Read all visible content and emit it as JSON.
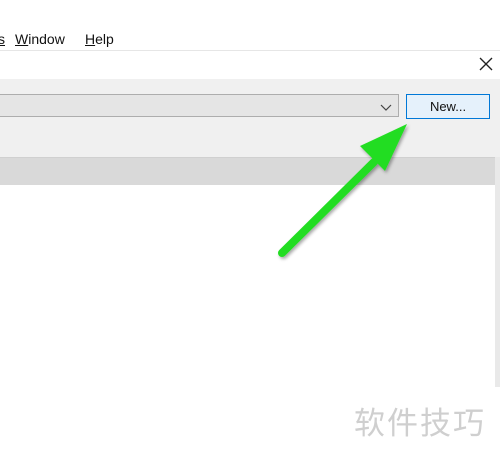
{
  "menubar": {
    "partial_item_tail": "s",
    "items": [
      {
        "accel": "W",
        "rest": "indow"
      },
      {
        "accel": "H",
        "rest": "elp"
      }
    ]
  },
  "dialog": {
    "selector": {
      "selected_value": ""
    },
    "new_button_label": "New..."
  },
  "annotation": {
    "arrow_color": "#22dd22"
  },
  "watermark": {
    "text": "软件技巧"
  },
  "icons": [
    "close-icon",
    "chevron-down-icon"
  ]
}
